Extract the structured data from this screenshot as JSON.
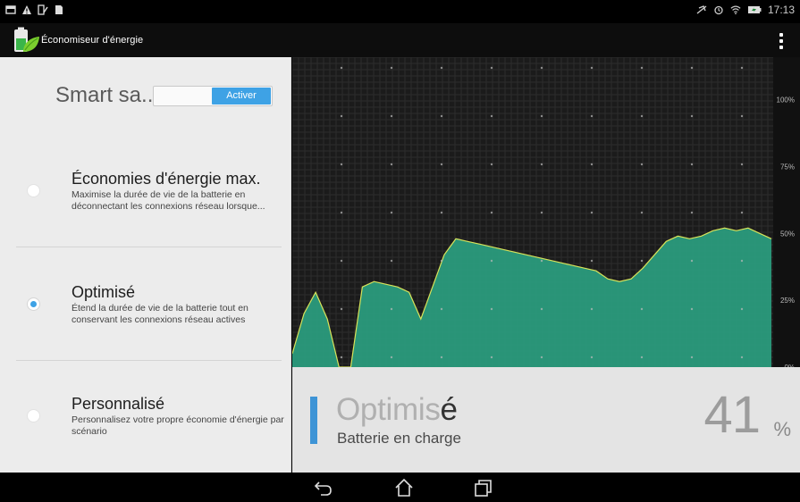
{
  "status_bar": {
    "time": "17:13",
    "left_icons": [
      "notification-icon",
      "warning-icon",
      "signal-edit-icon",
      "document-icon"
    ],
    "right_icons": [
      "no-location-icon",
      "alarm-icon",
      "wifi-icon",
      "battery-charging-icon"
    ]
  },
  "app_bar": {
    "title": "Économiseur d'énergie",
    "app_icon": "battery-leaf-icon",
    "menu_icon": "overflow-menu-icon"
  },
  "smart_saving": {
    "label": "Smart sa..",
    "button_label": "Activer"
  },
  "modes": [
    {
      "title": "Économies d'énergie max.",
      "description": "Maximise la durée de vie de la batterie en déconnectant les connexions réseau lorsque...",
      "selected": false
    },
    {
      "title": "Optimisé",
      "description": "Étend la durée de vie de la batterie tout en conservant les connexions réseau actives",
      "selected": true
    },
    {
      "title": "Personnalisé",
      "description": "Personnalisez votre propre économie d'énergie par scénario",
      "selected": false
    }
  ],
  "chart_data": {
    "type": "area",
    "y_labels": [
      "100%",
      "75%",
      "50%",
      "25%",
      "0%"
    ],
    "ylim": [
      0,
      100
    ],
    "grid": true,
    "series": [
      {
        "values": [
          5,
          20,
          28,
          18,
          0,
          0,
          30,
          32,
          31,
          30,
          28,
          18,
          30,
          42,
          48,
          47,
          46,
          45,
          44,
          43,
          42,
          41,
          40,
          39,
          38,
          37,
          36,
          33,
          32,
          33,
          37,
          42,
          47,
          49,
          48,
          49,
          51,
          52,
          51,
          52,
          50,
          48
        ]
      }
    ],
    "colors": {
      "fill": "#2a9e7f",
      "line": "#d7e35a",
      "background": "#1b1b1b",
      "grid": "#2d2d2d"
    }
  },
  "status_panel": {
    "mode_light": "Optimis",
    "mode_bold": "é",
    "subtitle": "Batterie en charge",
    "percent_value": "41",
    "percent_sign": "%"
  },
  "nav_bar": {
    "back_icon": "back-icon",
    "home_icon": "home-icon",
    "recents_icon": "recents-icon"
  }
}
